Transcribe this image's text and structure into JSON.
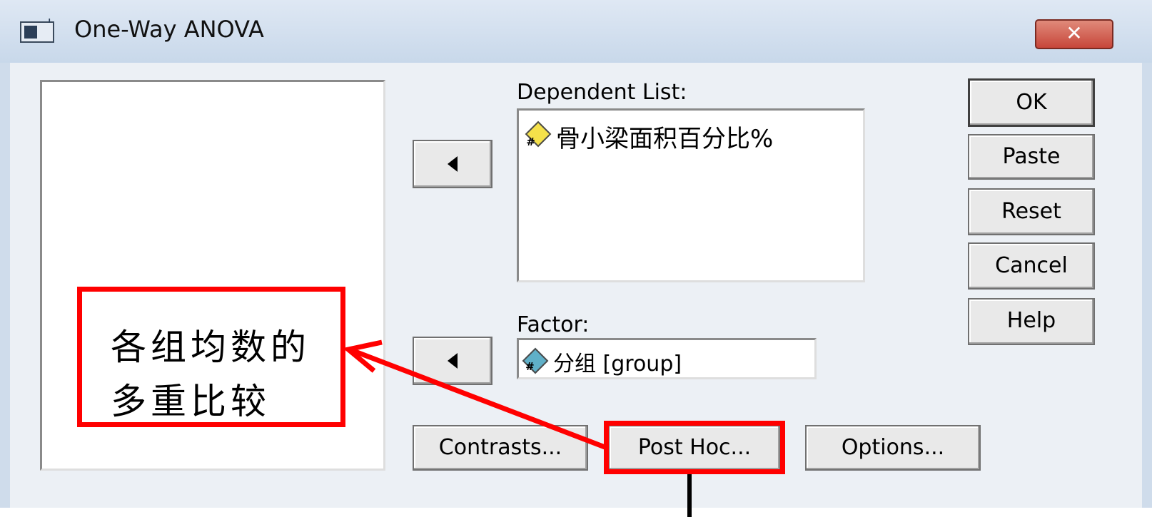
{
  "window": {
    "title": "One-Way ANOVA",
    "close_label": "✕"
  },
  "dependent_list": {
    "label": "Dependent List:",
    "items": [
      {
        "icon": "scale-variable-icon",
        "icon_color": "#f5e14a",
        "text": "骨小梁面积百分比%"
      }
    ]
  },
  "factor": {
    "label": "Factor:",
    "item": {
      "icon": "scale-variable-icon",
      "icon_color": "#5fb0c8",
      "text": "分组 [group]"
    }
  },
  "buttons": {
    "ok": "OK",
    "paste": "Paste",
    "reset": "Reset",
    "cancel": "Cancel",
    "help": "Help",
    "contrasts": "Contrasts...",
    "post_hoc": "Post Hoc...",
    "options": "Options..."
  },
  "annotation": {
    "line1": "各组均数的",
    "line2": "多重比较",
    "color": "#ff0000"
  }
}
